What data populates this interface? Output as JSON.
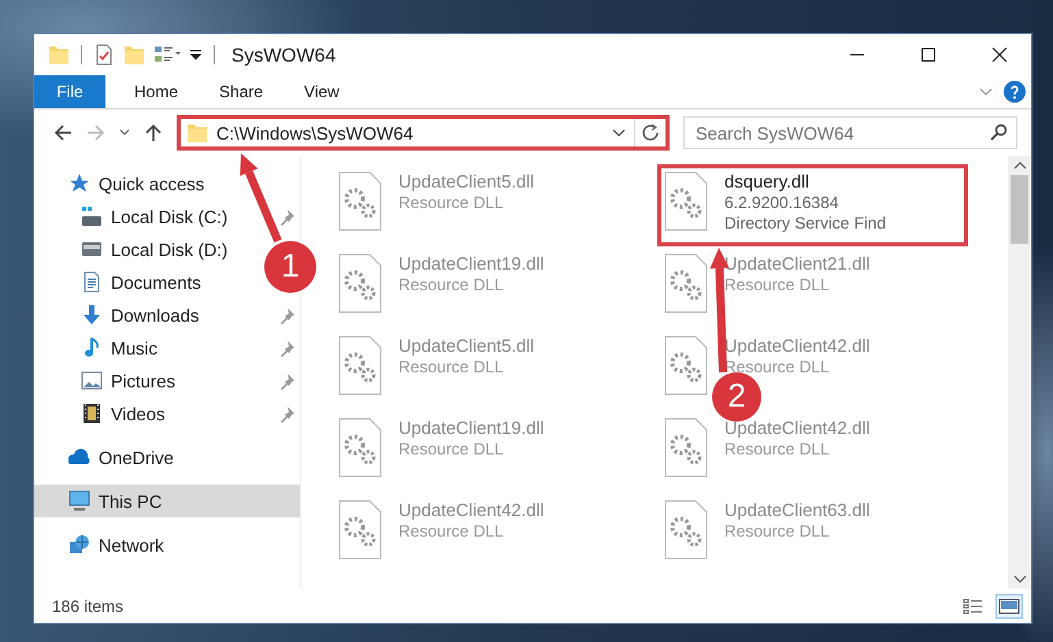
{
  "window": {
    "title": "SysWOW64"
  },
  "ribbon_tabs": [
    {
      "label": "File",
      "kind": "file",
      "selected": false
    },
    {
      "label": "Home",
      "kind": "tab",
      "selected": false
    },
    {
      "label": "Share",
      "kind": "tab",
      "selected": false
    },
    {
      "label": "View",
      "kind": "tab",
      "selected": false
    }
  ],
  "address": {
    "path": "C:\\Windows\\SysWOW64",
    "highlighted": true
  },
  "search": {
    "placeholder": "Search SysWOW64"
  },
  "nav": [
    {
      "label": "Quick access",
      "selected": false,
      "children": [
        {
          "label": "Local Disk (C:)",
          "pinned": true,
          "selected": false
        },
        {
          "label": "Local Disk (D:)",
          "pinned": false,
          "selected": false
        },
        {
          "label": "Documents",
          "pinned": false,
          "selected": false
        },
        {
          "label": "Downloads",
          "pinned": true,
          "selected": false
        },
        {
          "label": "Music",
          "pinned": true,
          "selected": false
        },
        {
          "label": "Pictures",
          "pinned": true,
          "selected": false
        },
        {
          "label": "Videos",
          "pinned": true,
          "selected": false
        }
      ]
    },
    {
      "label": "OneDrive",
      "selected": false
    },
    {
      "label": "This PC",
      "selected": true
    },
    {
      "label": "Network",
      "selected": false
    }
  ],
  "files": [
    {
      "name": "UpdateClient5.dll",
      "details": [
        "Resource DLL"
      ],
      "blurred": true,
      "highlighted": false
    },
    {
      "name": "dsquery.dll",
      "details": [
        "6.2.9200.16384",
        "Directory Service Find"
      ],
      "blurred": false,
      "highlighted": true
    },
    {
      "name": "UpdateClient19.dll",
      "details": [
        "Resource DLL"
      ],
      "blurred": true,
      "highlighted": false
    },
    {
      "name": "UpdateClient21.dll",
      "details": [
        "Resource DLL"
      ],
      "blurred": true,
      "highlighted": false
    },
    {
      "name": "UpdateClient5.dll",
      "details": [
        "Resource DLL"
      ],
      "blurred": true,
      "highlighted": false
    },
    {
      "name": "UpdateClient42.dll",
      "details": [
        "Resource DLL"
      ],
      "blurred": true,
      "highlighted": false
    },
    {
      "name": "UpdateClient19.dll",
      "details": [
        "Resource DLL"
      ],
      "blurred": true,
      "highlighted": false
    },
    {
      "name": "UpdateClient42.dll",
      "details": [
        "Resource DLL"
      ],
      "blurred": true,
      "highlighted": false
    },
    {
      "name": "UpdateClient42.dll",
      "details": [
        "Resource DLL"
      ],
      "blurred": true,
      "highlighted": false
    },
    {
      "name": "UpdateClient63.dll",
      "details": [
        "Resource DLL"
      ],
      "blurred": true,
      "highlighted": false
    }
  ],
  "status_bar": {
    "item_count": "186 items",
    "views": [
      {
        "selected": false
      },
      {
        "selected": true
      }
    ]
  },
  "annotations": [
    {
      "number": "1"
    },
    {
      "number": "2"
    }
  ]
}
